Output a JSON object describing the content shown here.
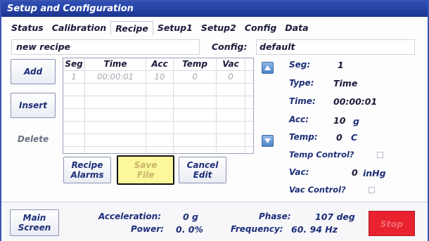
{
  "window": {
    "title": "Setup and Configuration"
  },
  "tabs": [
    "Status",
    "Calibration",
    "Recipe",
    "Setup1",
    "Setup2",
    "Config",
    "Data"
  ],
  "active_tab": "Recipe",
  "recipe_name": "new recipe",
  "config": {
    "label": "Config:",
    "value": "default"
  },
  "left_buttons": {
    "add": "Add",
    "insert": "Insert",
    "delete": "Delete"
  },
  "table": {
    "headers": [
      "Seg",
      "Time",
      "Acc",
      "Temp",
      "Vac"
    ],
    "rows": [
      [
        "1",
        "00:00:01",
        "10",
        "0",
        "0"
      ]
    ]
  },
  "bottom_buttons": {
    "recipe_alarms": [
      "Recipe",
      "Alarms"
    ],
    "save_file": [
      "Save",
      "File"
    ],
    "cancel_edit": [
      "Cancel",
      "Edit"
    ]
  },
  "segment_panel": {
    "seg": {
      "label": "Seg:",
      "value": "1"
    },
    "type": {
      "label": "Type:",
      "value": "Time"
    },
    "time": {
      "label": "Time:",
      "value": "00:00:01"
    },
    "acc": {
      "label": "Acc:",
      "value": "10",
      "unit": "g"
    },
    "temp": {
      "label": "Temp:",
      "value": "0",
      "unit": "C"
    },
    "temp_control": {
      "label": "Temp Control?",
      "checked": false
    },
    "vac": {
      "label": "Vac:",
      "value": "0",
      "unit": "inHg"
    },
    "vac_control": {
      "label": "Vac Control?",
      "checked": false
    }
  },
  "footer": {
    "main_screen": [
      "Main",
      "Screen"
    ],
    "acceleration": {
      "label": "Acceleration:",
      "value": "0 g"
    },
    "power": {
      "label": "Power:",
      "value": "0. 0%"
    },
    "phase": {
      "label": "Phase:",
      "value": "107 deg"
    },
    "frequency": {
      "label": "Frequency:",
      "value": "60. 94 Hz"
    },
    "stop": "Stop"
  },
  "colors": {
    "titlebar": "#1c3590",
    "save_highlight": "#fbf79a",
    "stop": "#e8222e"
  },
  "icons": [
    "up-arrow-icon",
    "down-arrow-icon",
    "checkbox-icon"
  ]
}
